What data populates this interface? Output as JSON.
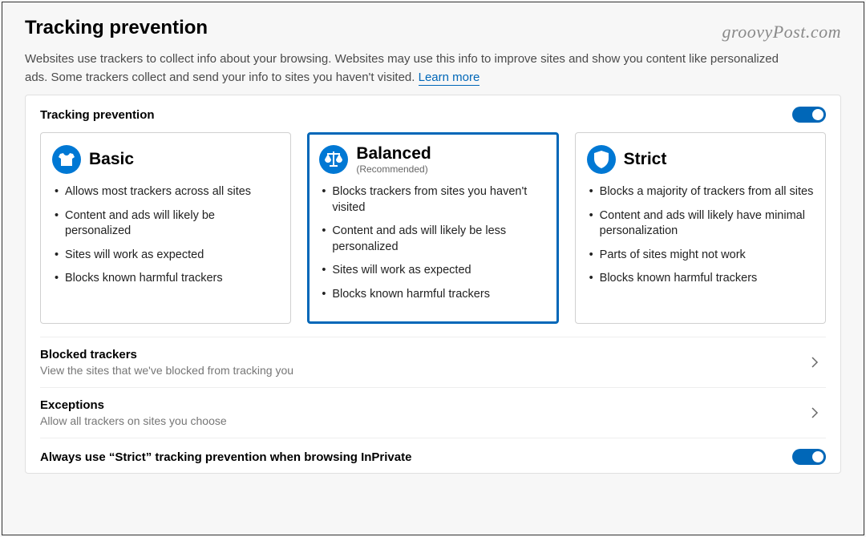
{
  "watermark": "groovyPost.com",
  "header": {
    "title": "Tracking prevention",
    "description": "Websites use trackers to collect info about your browsing. Websites may use this info to improve sites and show you content like personalized ads. Some trackers collect and send your info to sites you haven't visited. ",
    "learn_more": "Learn more"
  },
  "card": {
    "title": "Tracking prevention",
    "toggle_state": "on",
    "options": {
      "basic": {
        "title": "Basic",
        "subtitle": "",
        "items": [
          "Allows most trackers across all sites",
          "Content and ads will likely be personalized",
          "Sites will work as expected",
          "Blocks known harmful trackers"
        ]
      },
      "balanced": {
        "title": "Balanced",
        "subtitle": "(Recommended)",
        "items": [
          "Blocks trackers from sites you haven't visited",
          "Content and ads will likely be less personalized",
          "Sites will work as expected",
          "Blocks known harmful trackers"
        ]
      },
      "strict": {
        "title": "Strict",
        "subtitle": "",
        "items": [
          "Blocks a majority of trackers from all sites",
          "Content and ads will likely have minimal personalization",
          "Parts of sites might not work",
          "Blocks known harmful trackers"
        ]
      }
    },
    "blocked": {
      "title": "Blocked trackers",
      "desc": "View the sites that we've blocked from tracking you"
    },
    "exceptions": {
      "title": "Exceptions",
      "desc": "Allow all trackers on sites you choose"
    },
    "inprivate": {
      "title": "Always use “Strict” tracking prevention when browsing InPrivate",
      "toggle_state": "on"
    }
  }
}
